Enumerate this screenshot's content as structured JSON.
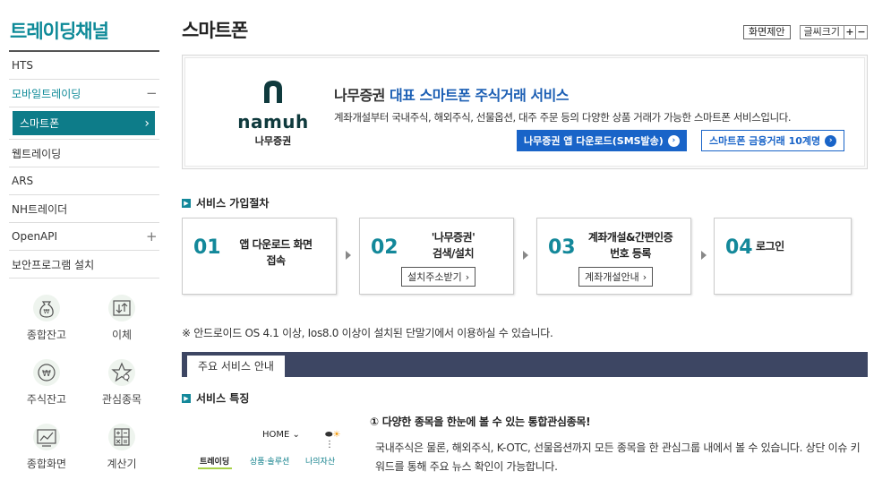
{
  "sidebar": {
    "title": "트레이딩채널",
    "items": [
      {
        "label": "HTS",
        "sign": ""
      },
      {
        "label": "모바일트레이딩",
        "sign": "−"
      },
      {
        "label": "웹트레이딩",
        "sign": ""
      },
      {
        "label": "ARS",
        "sign": ""
      },
      {
        "label": "NH트레이더",
        "sign": ""
      },
      {
        "label": "OpenAPI",
        "sign": "+"
      },
      {
        "label": "보안프로그램 설치",
        "sign": ""
      }
    ],
    "active_sub": "스마트폰",
    "quick_links": [
      "종합잔고",
      "이체",
      "주식잔고",
      "관심종목",
      "종합화면",
      "계산기"
    ]
  },
  "page": {
    "title": "스마트폰",
    "suggest_button": "화면제안",
    "font_size_label": "글씨크기",
    "plus": "+",
    "minus": "−"
  },
  "banner": {
    "logo_wordmark": "namuh",
    "logo_sub": "나무증권",
    "headline_company": "나무증권",
    "headline_rest": " 대표 스마트폰 주식거래 서비스",
    "description": "계좌개설부터 국내주식, 해외주식, 선물옵션, 대주 주문 등의 다양한 상품 거래가 가능한 스마트폰 서비스입니다.",
    "button_download": "나무증권 앱 다운로드(SMS발송)",
    "button_finance": "스마트폰 금융거래 10계명"
  },
  "procedure": {
    "title": "서비스 가입절차",
    "steps": [
      {
        "num": "01",
        "line1": "앱 다운로드 화면",
        "line2": "접속",
        "button": ""
      },
      {
        "num": "02",
        "line1": "'나무증권'",
        "line2": "검색/설치",
        "button": "설치주소받기"
      },
      {
        "num": "03",
        "line1": "계좌개설&간편인증",
        "line2": "번호 등록",
        "button": "계좌개설안내"
      },
      {
        "num": "04",
        "line1": "로그인",
        "line2": "",
        "button": ""
      }
    ]
  },
  "notice": "※ 안드로이드 OS 4.1 이상, Ios8.0 이상이 설치된 단말기에서 이용하실 수 있습니다.",
  "tab": "주요 서비스 안내",
  "features": {
    "title": "서비스 특징",
    "mock": {
      "home": "HOME",
      "tab1": "트레이딩",
      "tab2": "상품·솔루션",
      "tab3": "나의자산"
    },
    "item1_title": "① 다양한 종목을 한눈에 볼 수 있는 통합관심종목!",
    "item1_desc": "국내주식은 물론, 해외주식, K-OTC, 선물옵션까지 모든 종목을 한 관심그룹 내에서 볼 수 있습니다. 상단 이슈 키워드를 통해 주요 뉴스 확인이 가능합니다."
  },
  "colors": {
    "accent": "#0e8a98",
    "blue": "#1964c8",
    "tabbar": "#3d4663"
  }
}
